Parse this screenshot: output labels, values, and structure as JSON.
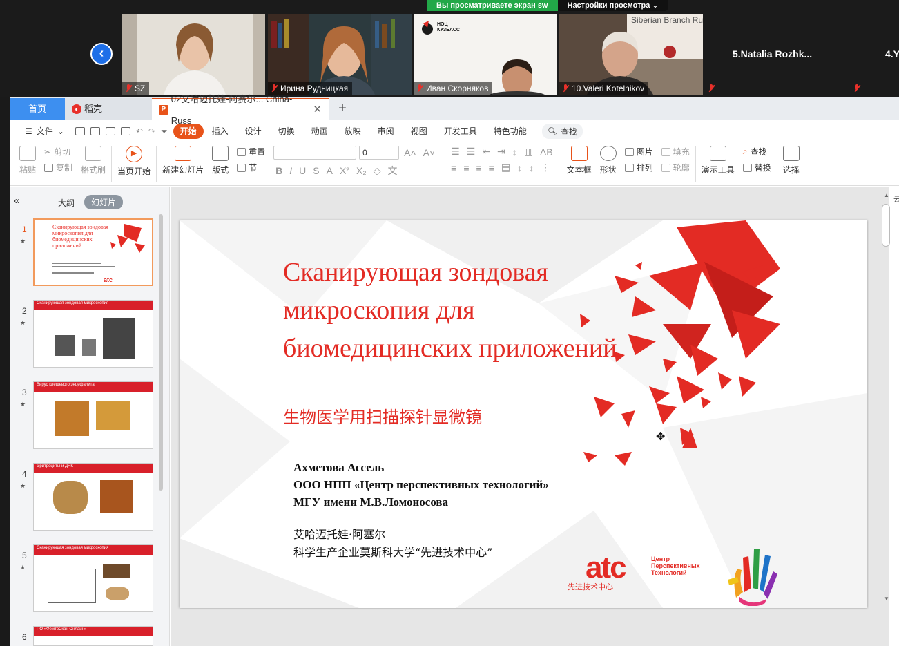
{
  "zoom": {
    "share_banner": "Вы просматриваете экран sw",
    "view_settings": "Настройки просмотра",
    "participants": [
      {
        "name": "SZ"
      },
      {
        "name": "Ирина Рудницкая"
      },
      {
        "name": "Иван Скорняков",
        "screen_text_1": "НОЦ",
        "screen_text_2": "КУЗБАСС"
      },
      {
        "name": "10.Valeri Kotelnikov",
        "backdrop_text": "Siberian Branch Russian Academ"
      },
      {
        "name": "5.Natalia  Rozhk..."
      },
      {
        "name": "4.Y"
      }
    ]
  },
  "wps": {
    "tabs": {
      "home": "首页",
      "docer": "稻壳",
      "doc": "02艾哈迈托娃-阿赛尔... China-Russ",
      "doc_icon": "P",
      "add": "+"
    },
    "menu": {
      "file": "文件",
      "items": [
        "开始",
        "插入",
        "设计",
        "切换",
        "动画",
        "放映",
        "审阅",
        "视图",
        "开发工具",
        "特色功能"
      ],
      "search": "查找"
    },
    "ribbon": {
      "paste": "粘贴",
      "cut": "剪切",
      "copy": "复制",
      "format_painter": "格式刷",
      "from_start": "当页开始",
      "new_slide": "新建幻灯片",
      "layout": "版式",
      "reset": "重置",
      "section": "节",
      "font_size": "0",
      "textbox": "文本框",
      "shape": "形状",
      "picture": "图片",
      "arrange": "排列",
      "fill": "填充",
      "outline": "轮廓",
      "present_tool": "演示工具",
      "find": "查找",
      "replace": "替换",
      "select": "选择"
    },
    "panel": {
      "collapse": "«",
      "outline": "大纲",
      "slides": "幻灯片",
      "thumbs": [
        {
          "num": "1",
          "title": "Сканирующая зондовая микроскопия для биомедицинских приложений"
        },
        {
          "num": "2",
          "title": "Сканирующая зондовая микроскопия"
        },
        {
          "num": "3",
          "title": "Вирус клещевого энцефалита"
        },
        {
          "num": "4",
          "title": "Эритроциты и ДНК"
        },
        {
          "num": "5",
          "title": "Сканирующая зондовая микроскопия"
        },
        {
          "num": "6",
          "title": "ПО «ФемтоСкан Онлайн»"
        }
      ]
    },
    "slide": {
      "title_ru": "Сканирующая зондовая микроскопия для биомедицинских приложений",
      "title_zh": "生物医学用扫描探针显微镜",
      "author_lines": [
        "Ахметова Ассель",
        "ООО НПП «Центр перспективных технологий»",
        "МГУ имени М.В.Ломоносова"
      ],
      "author_zh_lines": [
        "艾哈迈托娃·阿塞尔",
        "科学生产企业莫斯科大学“先进技术中心”"
      ],
      "logo": "atc",
      "logo_sub": "Центр Перспективных Технологий",
      "logo_zh": "先进技术中心",
      "accent": "#e32b24"
    },
    "right_label": "云"
  }
}
